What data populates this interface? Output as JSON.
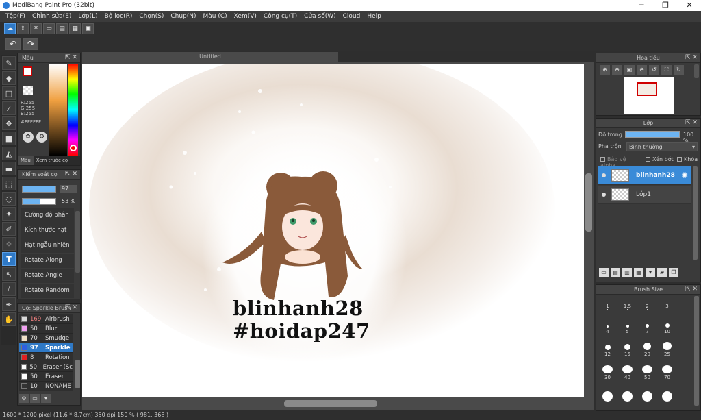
{
  "window": {
    "title": "MediBang Paint Pro (32bit)",
    "minimize": "─",
    "maximize": "❐",
    "close": "✕"
  },
  "menu": [
    "Tệp(F)",
    "Chỉnh sửa(E)",
    "Lớp(L)",
    "Bộ lọc(R)",
    "Chọn(S)",
    "Chụp(N)",
    "Màu (C)",
    "Xem(V)",
    "Công cụ(T)",
    "Cửa sổ(W)",
    "Cloud",
    "Help"
  ],
  "toolbar": {
    "undo": "↶",
    "redo": "↷"
  },
  "color_panel": {
    "title": "Màu",
    "rgb": [
      "R:255",
      "G:255",
      "B:255"
    ],
    "hex": "#FFFFFF",
    "tabs": [
      "Màu",
      "Xem trước cọ"
    ],
    "fg_color": "#ffffff",
    "accent": "#d10000"
  },
  "brush_control": {
    "title": "Kiểm soát cọ",
    "size_value": "97",
    "size_fraction": 0.97,
    "opacity_value": "53 %",
    "opacity_fraction": 0.53,
    "options": [
      "Cường độ phân",
      "Kích thước hạt",
      "Hạt ngẫu nhiên",
      "Rotate Along",
      "Rotate Angle",
      "Rotate Random"
    ]
  },
  "brush_list": {
    "title": "Cọ: Sparkle Brush",
    "items": [
      {
        "size": "169",
        "name": "Airbrush",
        "color": "#d8d8d8"
      },
      {
        "size": "50",
        "name": "Blur",
        "color": "#f0a0f0"
      },
      {
        "size": "70",
        "name": "Smudge",
        "color": "#f0e0c8"
      },
      {
        "size": "97",
        "name": "Sparkle",
        "color": "#2f5fe0",
        "selected": true
      },
      {
        "size": "8",
        "name": "Rotation",
        "color": "#e02020"
      },
      {
        "size": "50",
        "name": "Eraser (Sc",
        "color": "#ffffff"
      },
      {
        "size": "50",
        "name": "Eraser",
        "color": "#ffffff"
      },
      {
        "size": "10",
        "name": "NONAME",
        "color": "#333333"
      }
    ]
  },
  "document": {
    "tab": "Untitled",
    "canvas_text_1": "blinhanh28",
    "canvas_text_2": "#hoidap247"
  },
  "status": "1600 * 1200 pixel   (11.6 * 8.7cm)   350 dpi   150 %   ( 981, 368 )",
  "navigator": {
    "title": "Hoa tiêu"
  },
  "layers": {
    "title": "Lớp",
    "opacity_label": "Độ trong",
    "opacity_value": "100 %",
    "blend_label": "Pha trộn",
    "blend_value": "Bình thường",
    "protect_alpha": "Bảo vệ alpha",
    "clipping": "Xén bớt",
    "lock": "Khóa",
    "items": [
      {
        "name": "blinhanh28",
        "selected": true
      },
      {
        "name": "Lớp1",
        "selected": false
      }
    ]
  },
  "brush_size": {
    "title": "Brush Size",
    "sizes": [
      "1",
      "1.5",
      "2",
      "3",
      "4",
      "5",
      "7",
      "10",
      "12",
      "15",
      "20",
      "25",
      "30",
      "40",
      "50",
      "70",
      "",
      "",
      "",
      ""
    ]
  }
}
